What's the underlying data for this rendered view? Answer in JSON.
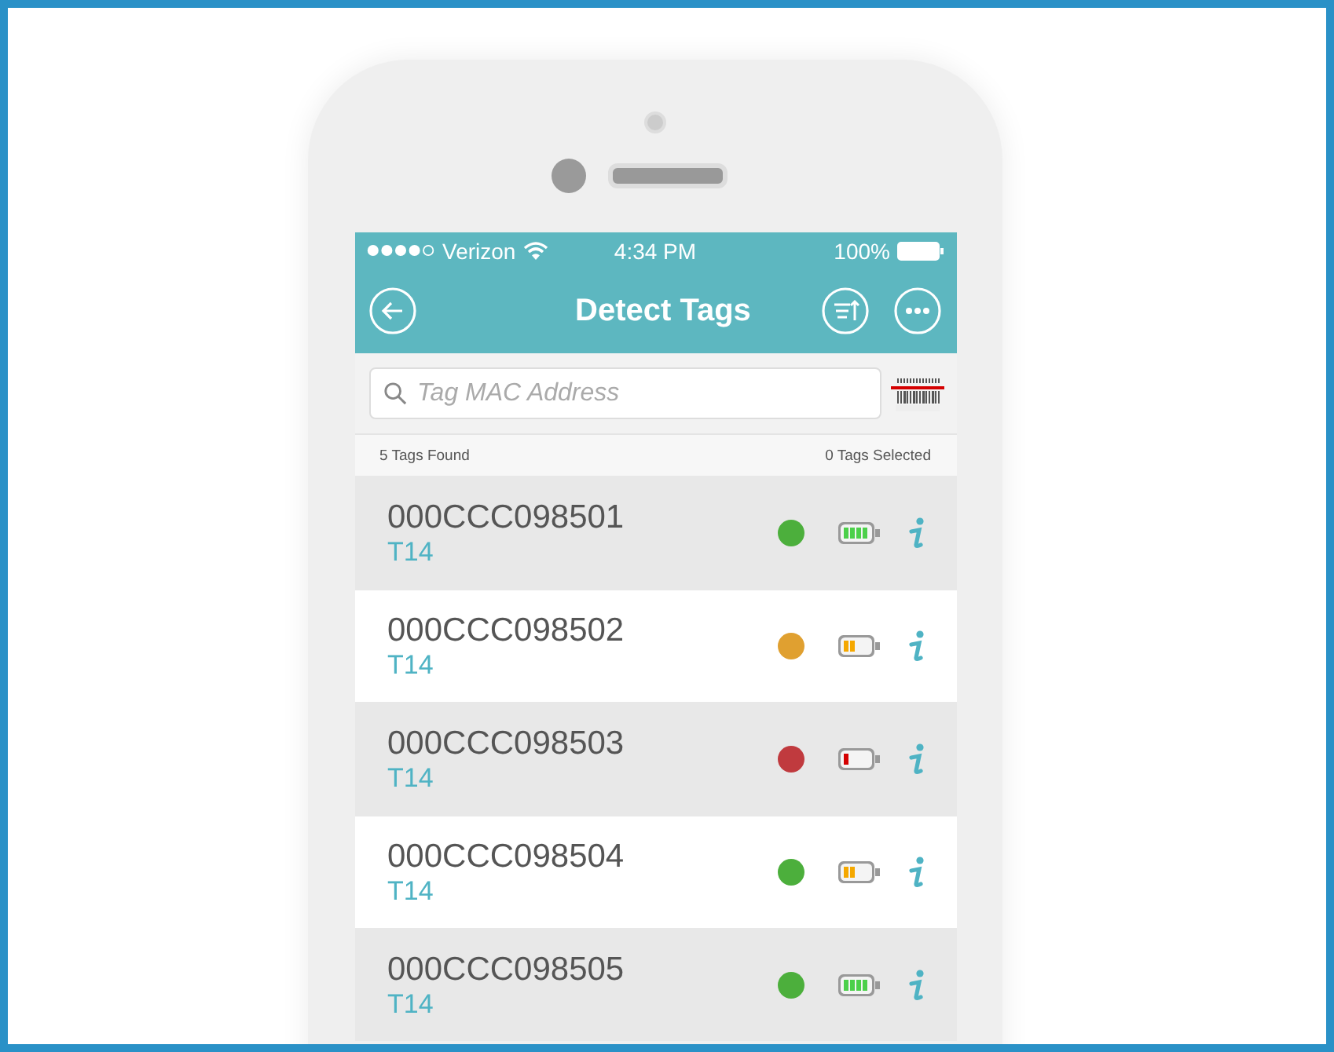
{
  "status_bar": {
    "carrier": "Verizon",
    "time": "4:34 PM",
    "battery": "100%"
  },
  "nav_bar": {
    "title": "Detect Tags"
  },
  "search": {
    "placeholder": "Tag MAC Address"
  },
  "summary": {
    "found": "5 Tags Found",
    "selected": "0 Tags Selected"
  },
  "tags": [
    {
      "id": "000CCC098501",
      "type": "T14",
      "color": "#4caf3c",
      "level": 1
    },
    {
      "id": "000CCC098502",
      "type": "T14",
      "color": "#e0a030",
      "level": 0.5
    },
    {
      "id": "000CCC098503",
      "type": "T14",
      "color": "#c03a3e",
      "level": 0.25
    },
    {
      "id": "000CCC098504",
      "type": "T14",
      "color": "#4caf3c",
      "level": 0.5
    },
    {
      "id": "000CCC098505",
      "type": "T14",
      "color": "#4caf3c",
      "level": 1
    }
  ]
}
